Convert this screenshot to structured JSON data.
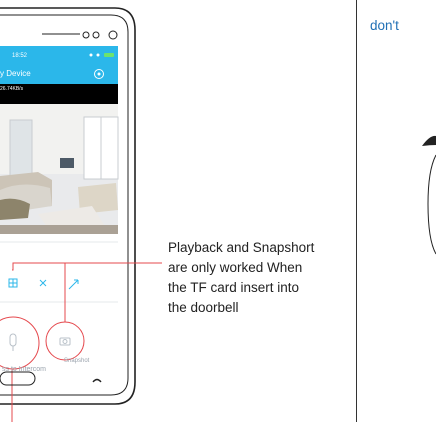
{
  "phone": {
    "time": "18:52",
    "title": "y Device",
    "speed": "26.74KB/s",
    "intercom_label": "ss to Intercom",
    "snapshot_label": "Snapshot"
  },
  "callout": {
    "line1": "Playback and Snapshort",
    "line2": "are only worked When",
    "line3": "the TF card insert into",
    "line4": "the doorbell"
  },
  "right_panel": {
    "text": "don't"
  },
  "colors": {
    "accent": "#2bb7ea",
    "annotation": "#e5484d",
    "phone_outline": "#222222",
    "ui_gray": "#cfd5dc"
  }
}
